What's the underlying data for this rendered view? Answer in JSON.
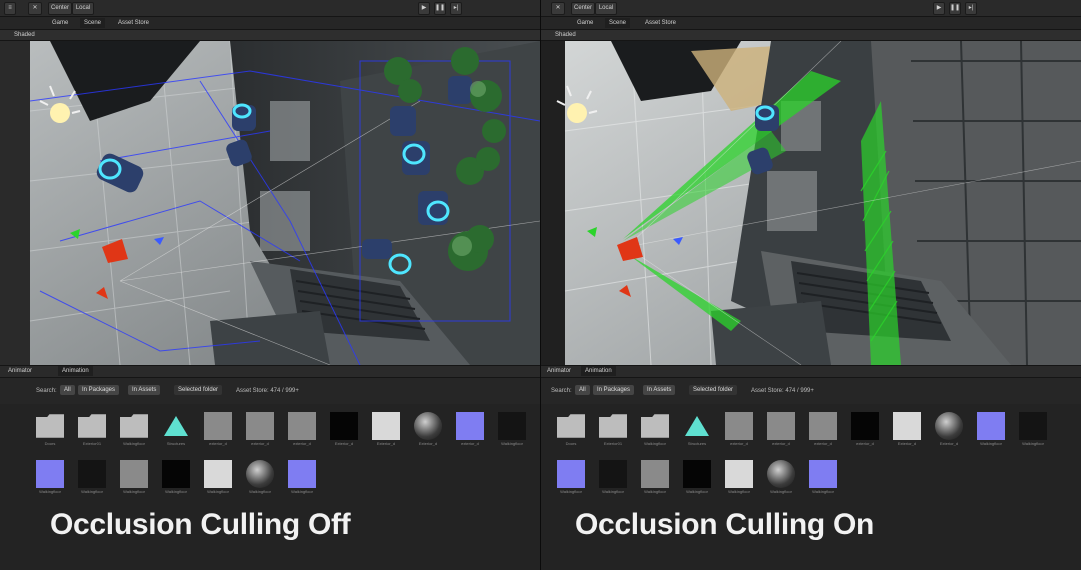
{
  "panels": [
    {
      "id": "left",
      "toolbar": {
        "center_label": "Center",
        "local_label": "Local"
      },
      "tabs": [
        "Game",
        "Scene",
        "Asset Store"
      ],
      "shading_mode": "Shaded",
      "bottom_tabs": [
        "Animator",
        "Animation"
      ],
      "search": {
        "label": "Search:",
        "scope_all": "All",
        "scope_packages": "In Packages",
        "scope_assets": "In Assets",
        "scope_folder": "Selected folder",
        "asset_store": "Asset Store: 474 / 999+"
      },
      "assets_row1": [
        {
          "kind": "folder",
          "label": "Doors"
        },
        {
          "kind": "folder",
          "label": "Exterior01"
        },
        {
          "kind": "folder",
          "label": "Walkingfloor"
        },
        {
          "kind": "tri",
          "label": "Structures"
        },
        {
          "kind": "gray",
          "label": "exterior_d"
        },
        {
          "kind": "gray",
          "label": "exterior_d"
        },
        {
          "kind": "gray",
          "label": "exterior_d"
        },
        {
          "kind": "black",
          "label": "Exterior_d"
        },
        {
          "kind": "white",
          "label": "Exterior_d"
        },
        {
          "kind": "ball",
          "label": "Exterior_d"
        },
        {
          "kind": "blue",
          "label": "exterior_d"
        },
        {
          "kind": "dark",
          "label": "Walkingfloor"
        }
      ],
      "assets_row2": [
        {
          "kind": "blue",
          "label": "Walkingfloor"
        },
        {
          "kind": "dark",
          "label": "Walkingfloor"
        },
        {
          "kind": "gray",
          "label": "Walkingfloor"
        },
        {
          "kind": "black",
          "label": "Walkingfloor"
        },
        {
          "kind": "white",
          "label": "Walkingfloor"
        },
        {
          "kind": "ball",
          "label": "Walkingfloor"
        },
        {
          "kind": "blue",
          "label": "Walkingfloor"
        }
      ],
      "caption": "Occlusion Culling Off"
    },
    {
      "id": "right",
      "toolbar": {
        "center_label": "Center",
        "local_label": "Local"
      },
      "tabs": [
        "Game",
        "Scene",
        "Asset Store"
      ],
      "shading_mode": "Shaded",
      "bottom_tabs": [
        "Animator",
        "Animation"
      ],
      "search": {
        "label": "Search:",
        "scope_all": "All",
        "scope_packages": "In Packages",
        "scope_assets": "In Assets",
        "scope_folder": "Selected folder",
        "asset_store": "Asset Store: 474 / 999+"
      },
      "assets_row1": [
        {
          "kind": "folder",
          "label": "Doors"
        },
        {
          "kind": "folder",
          "label": "Exterior01"
        },
        {
          "kind": "folder",
          "label": "Walkingfloor"
        },
        {
          "kind": "tri",
          "label": "Structures"
        },
        {
          "kind": "gray",
          "label": "exterior_d"
        },
        {
          "kind": "gray",
          "label": "exterior_d"
        },
        {
          "kind": "gray",
          "label": "exterior_d"
        },
        {
          "kind": "black",
          "label": "exterior_d"
        },
        {
          "kind": "white",
          "label": "Exterior_d"
        },
        {
          "kind": "ball",
          "label": "Exterior_d"
        },
        {
          "kind": "blue",
          "label": "Walkingfloor"
        },
        {
          "kind": "dark",
          "label": "Walkingfloor"
        },
        {
          "kind": "dark",
          "label": "Walkingfloor"
        }
      ],
      "assets_row2": [
        {
          "kind": "blue",
          "label": "Walkingfloor"
        },
        {
          "kind": "dark",
          "label": "Walkingfloor"
        },
        {
          "kind": "gray",
          "label": "Walkingfloor"
        },
        {
          "kind": "black",
          "label": "Walkingfloor"
        },
        {
          "kind": "white",
          "label": "Walkingfloor"
        },
        {
          "kind": "ball",
          "label": "Walkingfloor"
        },
        {
          "kind": "blue",
          "label": "Walkingfloor"
        }
      ],
      "caption": "Occlusion Culling On"
    }
  ],
  "colors": {
    "frustum_green": "#2bd42b",
    "wire_blue": "#2a38ff",
    "accent_blue": "#7f7df2"
  }
}
